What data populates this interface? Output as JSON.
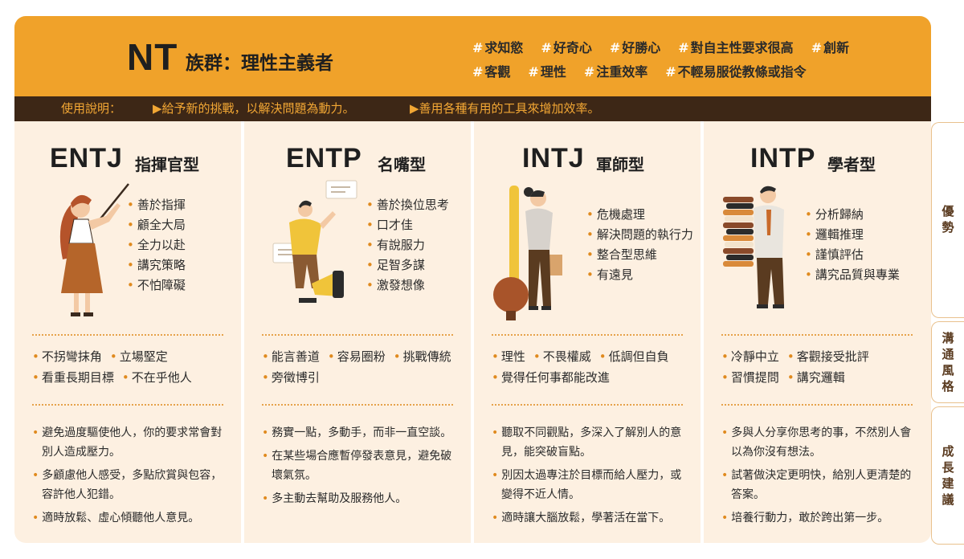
{
  "header": {
    "group_code": "NT",
    "group_name": "族群：理性主義者",
    "tags_row1": [
      "求知慾",
      "好奇心",
      "好勝心",
      "對自主性要求很高",
      "創新"
    ],
    "tags_row2": [
      "客觀",
      "理性",
      "注重效率",
      "不輕易服從教條或指令"
    ]
  },
  "usage": {
    "label": "使用說明：",
    "tip1": "▶給予新的挑戰，以解決問題為動力。",
    "tip2": "▶善用各種有用的工具來增加效率。"
  },
  "side_tabs": [
    "優勢",
    "溝通風格",
    "成長建議"
  ],
  "types": [
    {
      "code": "ENTJ",
      "name": "指揮官型",
      "strengths": [
        "善於指揮",
        "顧全大局",
        "全力以赴",
        "講究策略",
        "不怕障礙"
      ],
      "communication": [
        "不拐彎抹角",
        "立場堅定",
        "看重長期目標",
        "不在乎他人"
      ],
      "advice": [
        "避免過度驅使他人，你的要求常會對別人造成壓力。",
        "多顧慮他人感受，多點欣賞與包容，容許他人犯錯。",
        "適時放鬆、虛心傾聽他人意見。"
      ]
    },
    {
      "code": "ENTP",
      "name": "名嘴型",
      "strengths": [
        "善於換位思考",
        "口才佳",
        "有說服力",
        "足智多謀",
        "激發想像"
      ],
      "communication": [
        "能言善道",
        "容易圈粉",
        "挑戰傳統",
        "旁徵博引"
      ],
      "advice": [
        "務實一點，多動手，而非一直空談。",
        "在某些場合應暫停發表意見，避免破壞氣氛。",
        "多主動去幫助及服務他人。"
      ]
    },
    {
      "code": "INTJ",
      "name": "軍師型",
      "strengths": [
        "危機處理",
        "解決問題的執行力",
        "整合型思維",
        "有遠見"
      ],
      "communication": [
        "理性",
        "不畏權威",
        "低調但自負",
        "覺得任何事都能改進"
      ],
      "advice": [
        "聽取不同觀點，多深入了解別人的意見，能突破盲點。",
        "別因太過專注於目標而給人壓力，或變得不近人情。",
        "適時讓大腦放鬆，學著活在當下。"
      ]
    },
    {
      "code": "INTP",
      "name": "學者型",
      "strengths": [
        "分析歸納",
        "邏輯推理",
        "謹慎評估",
        "講究品質與專業"
      ],
      "communication": [
        "冷靜中立",
        "客觀接受批評",
        "習慣提問",
        "講究邏輯"
      ],
      "advice": [
        "多與人分享你思考的事，不然別人會以為你沒有想法。",
        "試著做決定更明快，給別人更清楚的答案。",
        "培養行動力，敢於跨出第一步。"
      ]
    }
  ],
  "icons": [
    "teacher-illustration",
    "speaker-illustration",
    "strategist-illustration",
    "scholar-illustration"
  ],
  "colors": {
    "accent": "#f0a22a",
    "dark": "#3d2716",
    "panel": "#fdf0e1",
    "bullet": "#e08a1e"
  }
}
